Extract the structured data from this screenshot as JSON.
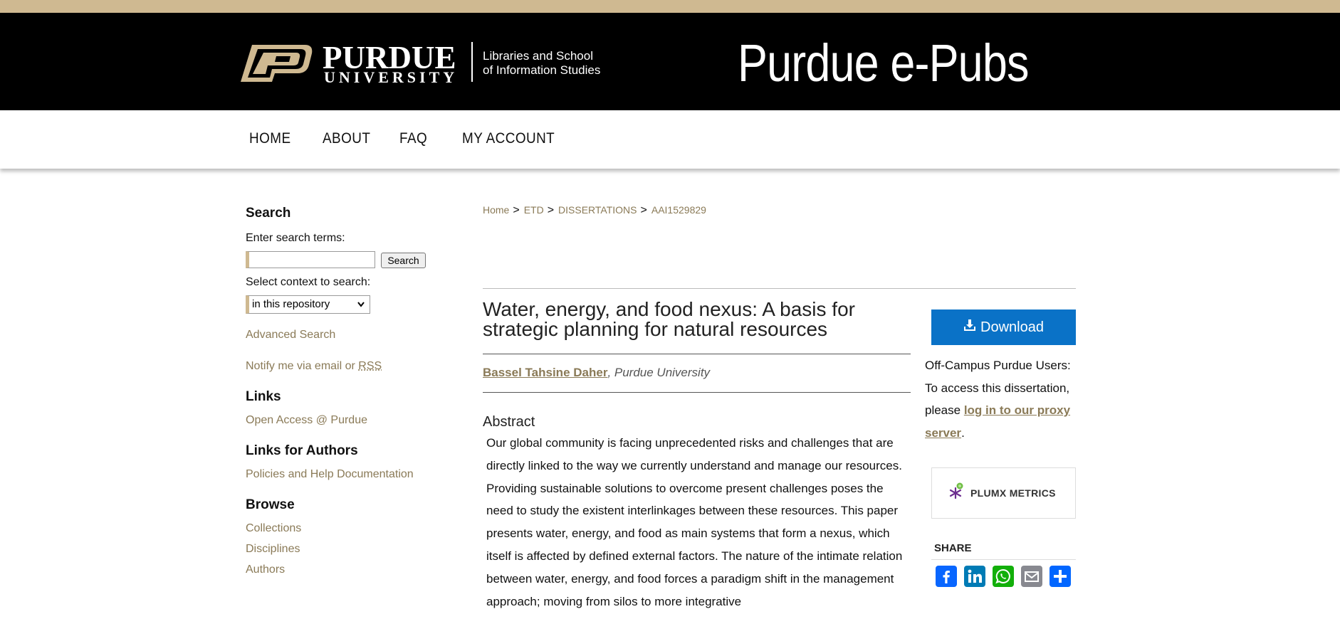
{
  "header": {
    "logo_wordmark": "PURDUE",
    "logo_university": "UNIVERSITY",
    "logo_subtitle_line1": "Libraries and School",
    "logo_subtitle_line2": "of Information Studies",
    "site_title": "Purdue e-Pubs"
  },
  "nav": {
    "items": [
      "HOME",
      "ABOUT",
      "FAQ",
      "MY ACCOUNT"
    ]
  },
  "sidebar": {
    "search_heading": "Search",
    "search_prompt": "Enter search terms:",
    "search_value": "",
    "search_button": "Search",
    "context_prompt": "Select context to search:",
    "context_selected": "in this repository",
    "advanced_search": "Advanced Search",
    "notify_text": "Notify me via email or ",
    "rss": "RSS",
    "links_heading": "Links",
    "links_item": "Open Access @ Purdue",
    "authors_heading": "Links for Authors",
    "authors_item": "Policies and Help Documentation",
    "browse_heading": "Browse",
    "browse_items": [
      "Collections",
      "Disciplines",
      "Authors"
    ]
  },
  "breadcrumb": {
    "items": [
      "Home",
      "ETD",
      "DISSERTATIONS",
      "AAI1529829"
    ],
    "separator": ">"
  },
  "document": {
    "title": "Water, energy, and food nexus: A basis for strategic planning for natural resources",
    "author_name": "Bassel Tahsine Daher",
    "author_affiliation": ", Purdue University",
    "abstract_heading": "Abstract",
    "abstract_text": "Our global community is facing unprecedented risks and challenges that are directly linked to the way we currently understand and manage our resources. Providing sustainable solutions to overcome present challenges poses the need to study the existent interlinkages between these resources. This paper presents water, energy, and food as main systems that form a nexus, which itself is affected by defined external factors. The nature of the intimate relation between water, energy, and food forces a paradigm shift in the management approach; moving from silos to more integrative"
  },
  "aside": {
    "download_label": "Download",
    "offcampus_text": "Off-Campus Purdue Users: To access this dissertation, please ",
    "proxy_link": "log in to our proxy server",
    "offcampus_end": ".",
    "plumx_label": "PLUMX METRICS",
    "share_heading": "SHARE",
    "share_icons": [
      "facebook-icon",
      "linkedin-icon",
      "whatsapp-icon",
      "email-icon",
      "share-icon"
    ]
  },
  "colors": {
    "gold": "#cfb991",
    "link": "#8a7a57",
    "download": "#0a72c7",
    "facebook": "#0866ff",
    "linkedin": "#007bb5",
    "whatsapp": "#12af0a",
    "email": "#888990",
    "share": "#0166ff"
  }
}
